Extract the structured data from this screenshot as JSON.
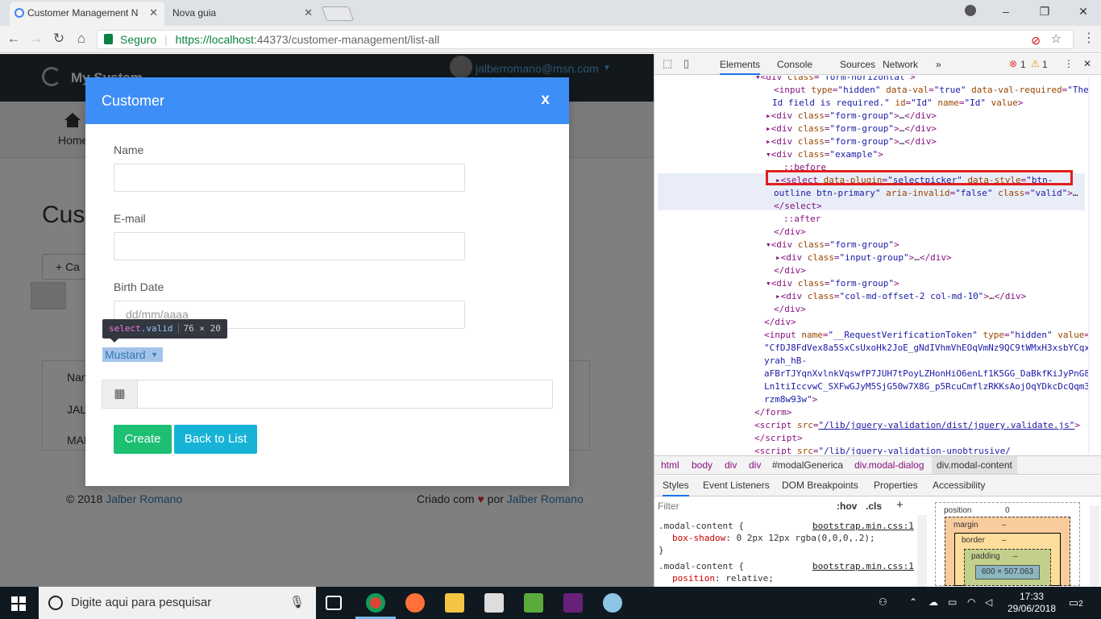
{
  "browser": {
    "tabs": [
      {
        "title": "Customer Management N"
      },
      {
        "title": "Nova guia"
      }
    ],
    "window_controls": {
      "minimize": "–",
      "maximize": "❐",
      "close": "✕"
    },
    "secure_label": "Seguro",
    "url_scheme_host": "https://localhost",
    "url_rest": ":44373/customer-management/list-all"
  },
  "page": {
    "brand": "My System",
    "user_email": "jalberromano@msn.com",
    "nav_home": "Home",
    "title_partial": "Cust",
    "add_partial": "+ Ca",
    "table": {
      "col_partial": "Nan",
      "row1_partial": "JAL",
      "row2_partial": "MAR"
    },
    "footer_left_prefix": "© 2018 ",
    "footer_left_link": "Jalber Romano",
    "footer_right_prefix": "Criado com ",
    "footer_right_mid": " por ",
    "footer_right_link": "Jalber Romano"
  },
  "modal": {
    "title": "Customer",
    "close": "x",
    "fields": [
      {
        "label": "Name",
        "value": ""
      },
      {
        "label": "E-mail",
        "value": ""
      },
      {
        "label": "Birth Date",
        "placeholder": "dd/mm/aaaa"
      }
    ],
    "tooltip": {
      "tag": "select",
      "cls": ".valid",
      "dims": "76 × 20"
    },
    "select_value": "Mustard",
    "buttons": {
      "create": "Create",
      "back": "Back to List"
    },
    "colors": {
      "header": "#3e8ef7",
      "create": "#1dbf73",
      "back": "#17b3d6"
    }
  },
  "devtools": {
    "tabs": [
      "Elements",
      "Console",
      "Sources",
      "Network",
      "»"
    ],
    "errors": "1",
    "warnings": "1",
    "breadcrumbs": [
      "html",
      "body",
      "div",
      "div",
      "#modalGenerica",
      "div.modal-dialog",
      "div.modal-content"
    ],
    "subtabs": [
      "Styles",
      "Event Listeners",
      "DOM Breakpoints",
      "Properties",
      "Accessibility"
    ],
    "filter_placeholder": "Filter",
    "hov": ":hov",
    "cls": ".cls",
    "plus": "+",
    "style_rules": [
      {
        "selector": ".modal-content {",
        "source": "bootstrap.min.css:1",
        "prop": "box-shadow",
        "value": "0 2px 12px rgba(0,0,0,.2);"
      },
      {
        "selector": ".modal-content {",
        "source": "bootstrap.min.css:1",
        "prop": "position",
        "value": "relative;"
      }
    ],
    "box_model": {
      "position": "position",
      "position_val": "0",
      "margin": "margin",
      "border": "border",
      "padding": "padding",
      "dash": "–",
      "content": "600 × 507.063"
    }
  },
  "taskbar": {
    "search_placeholder": "Digite aqui para pesquisar",
    "time": "17:33",
    "date": "29/06/2018",
    "notifications": "2"
  }
}
